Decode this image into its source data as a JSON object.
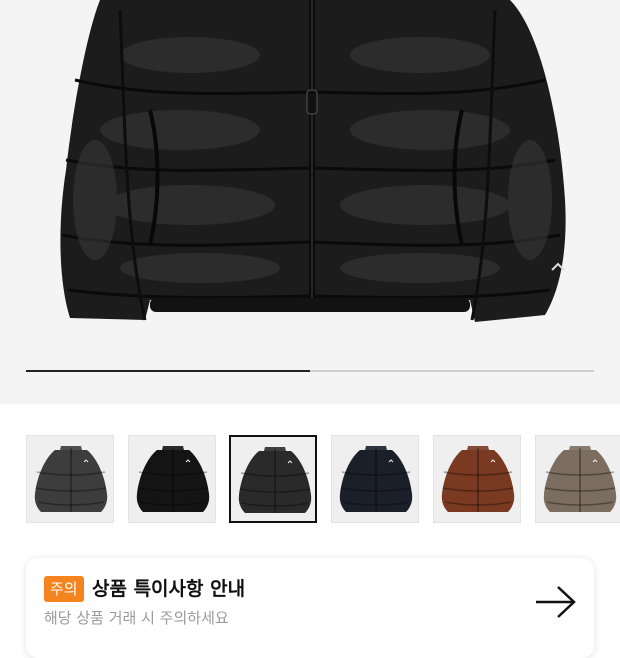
{
  "gallery": {
    "progress_fraction": 0.5,
    "thumbnails": [
      {
        "color": "#3c3d3c",
        "selected": false
      },
      {
        "color": "#141414",
        "selected": false
      },
      {
        "color": "#2a2a2a",
        "selected": true
      },
      {
        "color": "#1b1f2a",
        "selected": false
      },
      {
        "color": "#7a3a22",
        "selected": false
      },
      {
        "color": "#7b6d60",
        "selected": false
      }
    ]
  },
  "notice": {
    "badge": "주의",
    "title": "상품 특이사항 안내",
    "subtitle": "해당 상품 거래 시 주의하세요",
    "accent_color": "#f5841f",
    "arrow_icon": "arrow-right-icon"
  }
}
